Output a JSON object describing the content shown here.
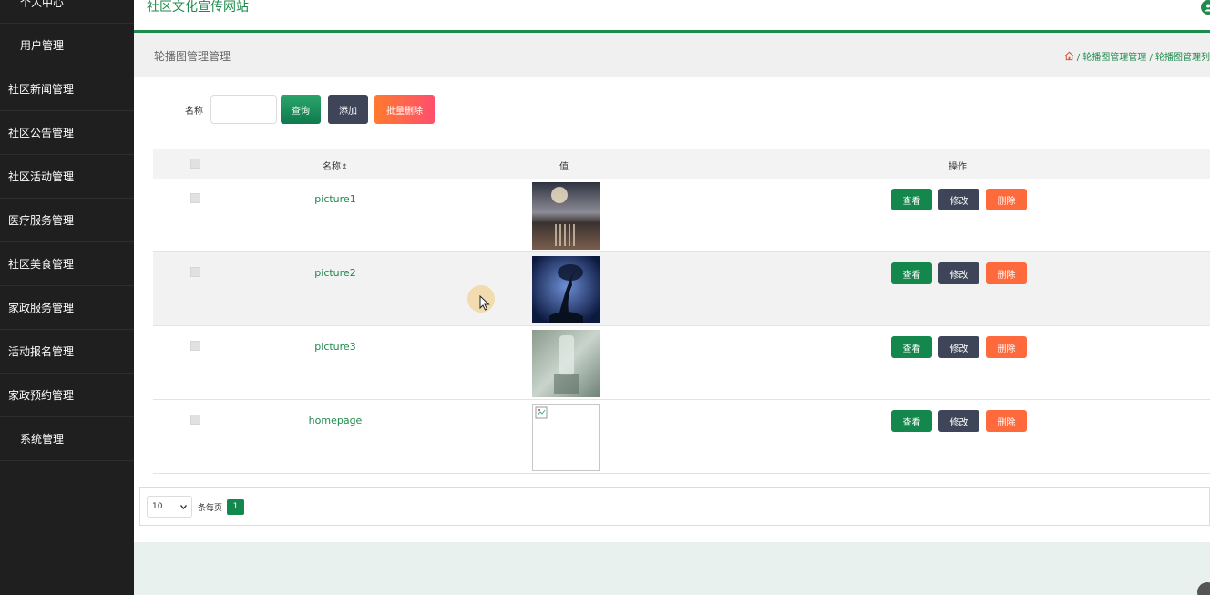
{
  "sidebar": {
    "items": [
      {
        "label": "个人中心"
      },
      {
        "label": "用户管理"
      },
      {
        "label": "社区新闻管理"
      },
      {
        "label": "社区公告管理"
      },
      {
        "label": "社区活动管理"
      },
      {
        "label": "医疗服务管理"
      },
      {
        "label": "社区美食管理"
      },
      {
        "label": "家政服务管理"
      },
      {
        "label": "活动报名管理"
      },
      {
        "label": "家政预约管理"
      },
      {
        "label": "系统管理"
      }
    ]
  },
  "header": {
    "title": "社区文化宣传网站"
  },
  "page": {
    "title": "轮播图管理管理",
    "breadcrumb": "/ 轮播图管理管理 / 轮播图管理列"
  },
  "search": {
    "label": "名称",
    "value": "",
    "query_label": "查询",
    "add_label": "添加",
    "batch_delete_label": "批量删除"
  },
  "table": {
    "headers": {
      "name": "名称",
      "value": "值",
      "ops": "操作"
    },
    "sort_glyph": "⇕",
    "rows": [
      {
        "name": "picture1"
      },
      {
        "name": "picture2"
      },
      {
        "name": "picture3"
      },
      {
        "name": "homepage"
      }
    ],
    "ops": {
      "view": "查看",
      "edit": "修改",
      "delete": "删除"
    }
  },
  "pagination": {
    "page_size": "10",
    "per_page_label": "条每页",
    "current_page": "1"
  },
  "colors": {
    "accent": "#1e8a4c",
    "sidebar_bg": "#1f1f1f",
    "edit_btn": "#3f4558",
    "delete_btn": "#ff6a3d"
  }
}
